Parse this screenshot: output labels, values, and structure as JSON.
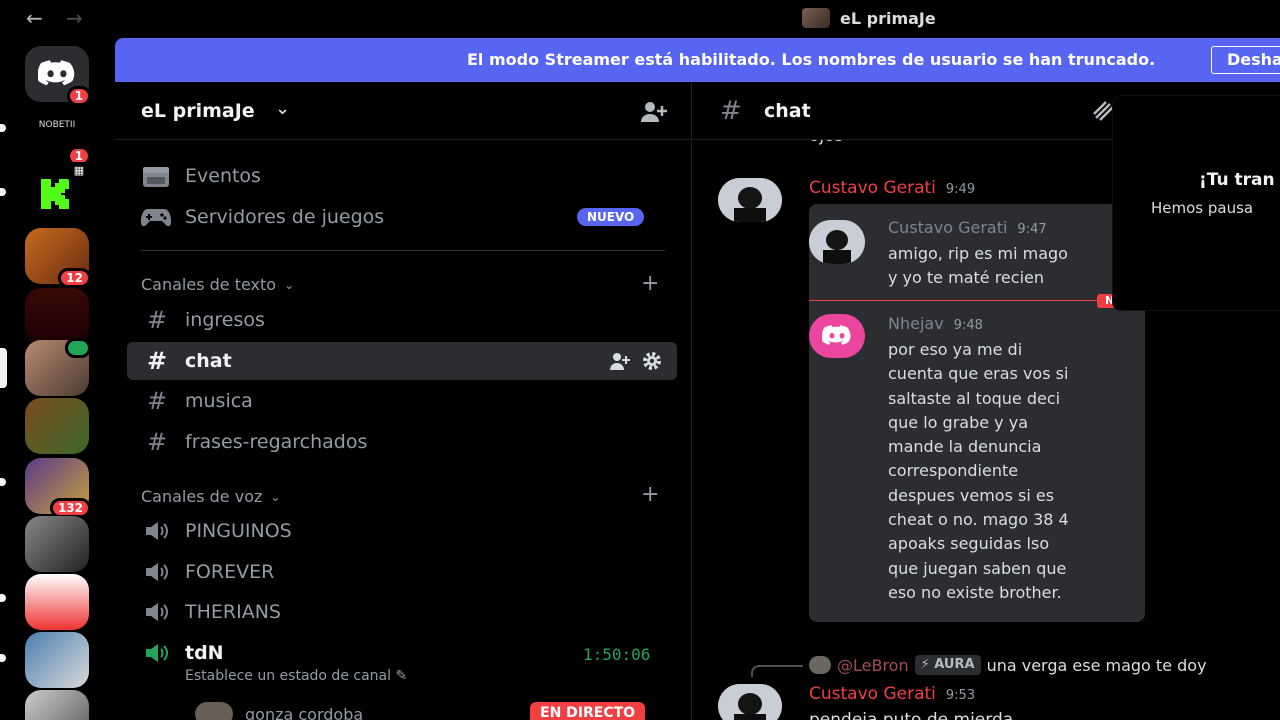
{
  "titlebar": {
    "back": "←",
    "forward": "→",
    "title": "eL primaJe"
  },
  "rail": {
    "badges": [
      "1",
      "1",
      "12",
      "132"
    ],
    "home_logo_text": "NOBETII"
  },
  "banner": {
    "text": "El modo Streamer está habilitado. Los nombres de usuario se han truncado.",
    "button": "Desha"
  },
  "guild": {
    "name": "eL primaJe"
  },
  "sidebar": {
    "events": "Eventos",
    "game_servers": "Servidores de juegos",
    "new_badge": "NUEVO",
    "text_category": "Canales de texto",
    "text_channels": [
      "ingresos",
      "chat",
      "musica",
      "frases-regarchados"
    ],
    "voice_category": "Canales de voz",
    "voice_channels": [
      "PINGUINOS",
      "FOREVER",
      "THERIANS",
      "tdN"
    ],
    "active_voice": {
      "time": "1:50:06",
      "status": "Establece un estado de canal",
      "user": "gonza cordoba",
      "live": "EN DIRECTO"
    }
  },
  "chat": {
    "channel": "chat",
    "top_fragment": "ojos",
    "msg1": {
      "author": "Custavo Gerati",
      "time": "9:49"
    },
    "embed": {
      "q_author": "Custavo Gerati",
      "q_time": "9:47",
      "q_lines": [
        "amigo, rip es mi mago",
        "y yo te maté recien"
      ],
      "new_label": "NUE",
      "r_author": "Nhejav",
      "r_time": "9:48",
      "r_lines": [
        "por eso ya me di",
        "cuenta que eras vos si",
        "saltaste al toque deci",
        "que lo grabe y ya",
        "mande la denuncia",
        "correspondiente",
        "despues vemos si es",
        "cheat o no. mago 38 4",
        "apoaks seguidas lso",
        "que juegan saben que",
        "eso no existe brother."
      ]
    },
    "reply": {
      "name": "@LeBron",
      "tag": "AURA",
      "text": "una verga ese mago te doy"
    },
    "msg2": {
      "author": "Custavo Gerati",
      "time": "9:53",
      "text": "pendeja puto de mierda"
    }
  },
  "popup": {
    "title": "¡Tu tran",
    "subtitle": "Hemos pausa"
  },
  "colors": {
    "accent": "#5865f2",
    "danger": "#f23f43",
    "online": "#23a55a",
    "pink": "#eb459e"
  }
}
